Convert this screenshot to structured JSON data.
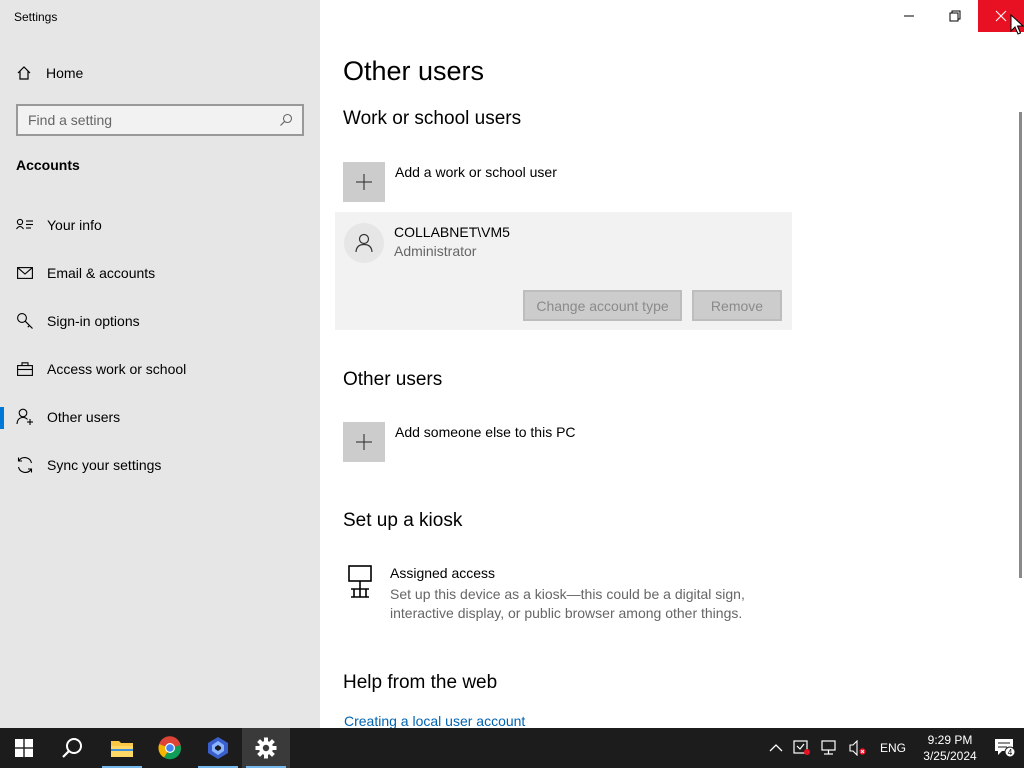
{
  "window": {
    "title": "Settings"
  },
  "sidebar": {
    "home_label": "Home",
    "search_placeholder": "Find a setting",
    "section_label": "Accounts",
    "items": [
      {
        "label": "Your info",
        "icon": "person-card-icon"
      },
      {
        "label": "Email & accounts",
        "icon": "mail-icon"
      },
      {
        "label": "Sign-in options",
        "icon": "key-icon"
      },
      {
        "label": "Access work or school",
        "icon": "briefcase-icon"
      },
      {
        "label": "Other users",
        "icon": "person-add-icon",
        "active": true
      },
      {
        "label": "Sync your settings",
        "icon": "sync-icon"
      }
    ]
  },
  "main": {
    "page_title": "Other users",
    "work_school": {
      "heading": "Work or school users",
      "add_label": "Add a work or school user",
      "user": {
        "name": "COLLABNET\\VM5",
        "role": "Administrator",
        "change_button": "Change account type",
        "remove_button": "Remove"
      }
    },
    "other_users": {
      "heading": "Other users",
      "add_label": "Add someone else to this PC"
    },
    "kiosk": {
      "heading": "Set up a kiosk",
      "title": "Assigned access",
      "description": "Set up this device as a kiosk—this could be a digital sign, interactive display, or public browser among other things."
    },
    "help": {
      "heading": "Help from the web",
      "link": "Creating a local user account"
    }
  },
  "taskbar": {
    "apps": [
      "start-icon",
      "search-icon",
      "file-explorer-icon",
      "chrome-icon",
      "app-icon",
      "settings-icon"
    ],
    "language": "ENG",
    "time": "9:29 PM",
    "date": "3/25/2024",
    "notification_count": "4"
  },
  "colors": {
    "accent": "#0078d7",
    "close_red": "#e81123",
    "sidebar_bg": "#e6e6e6",
    "link": "#0063b1"
  }
}
